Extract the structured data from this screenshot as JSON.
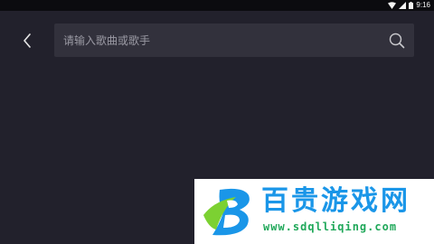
{
  "status_bar": {
    "time": "9:16"
  },
  "search": {
    "placeholder": "请输入歌曲或歌手",
    "value": ""
  },
  "watermark": {
    "title": "百贵游戏网",
    "url": "www.sdqlliqing.com"
  },
  "colors": {
    "background": "#22212c",
    "search_box": "#32313c",
    "watermark_blue": "#1a96e8",
    "watermark_green": "#20a85a"
  }
}
